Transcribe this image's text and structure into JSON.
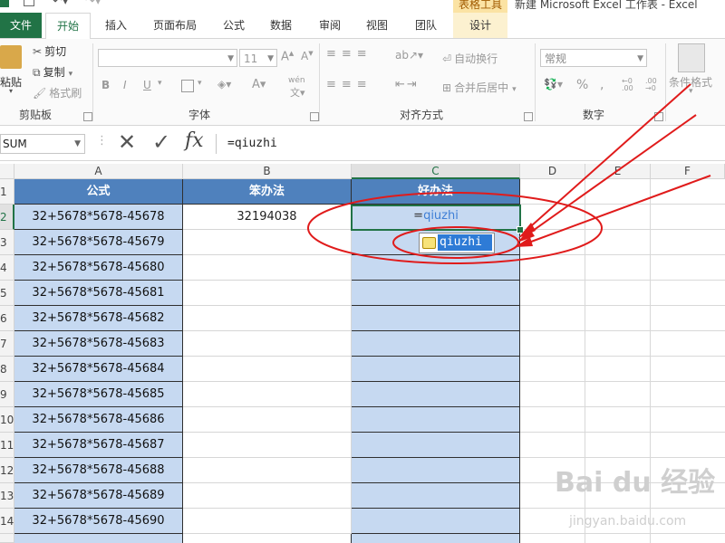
{
  "window": {
    "title": "新建 Microsoft Excel 工作表 - Excel",
    "context_tab_group": "表格工具"
  },
  "ribbon_tabs": [
    "文件",
    "开始",
    "插入",
    "页面布局",
    "公式",
    "数据",
    "审阅",
    "视图",
    "团队",
    "设计"
  ],
  "clipboard": {
    "paste": "粘贴",
    "cut": "剪切",
    "copy": "复制",
    "format_painter": "格式刷",
    "group": "剪贴板"
  },
  "font": {
    "size": "11",
    "group": "字体",
    "bold": "B",
    "italic": "I",
    "underline": "U",
    "phonetic": "wén"
  },
  "alignment": {
    "wrap_text": "自动换行",
    "merge_center": "合并后居中",
    "group": "对齐方式"
  },
  "number": {
    "format": "常规",
    "group": "数字",
    "percent": "%"
  },
  "styles": {
    "conditional_format": "条件格式"
  },
  "formula_bar": {
    "name_box": "SUM",
    "cancel": "✕",
    "enter": "✓",
    "fx": "fx",
    "content": "=qiuzhi"
  },
  "columns": [
    "A",
    "B",
    "C",
    "D",
    "E",
    "F"
  ],
  "rows": [
    "1",
    "2",
    "3",
    "4",
    "5",
    "6",
    "7",
    "8",
    "9",
    "10",
    "11",
    "12",
    "13",
    "14"
  ],
  "table": {
    "headers": [
      "公式",
      "笨办法",
      "好办法"
    ],
    "formulas": [
      "32+5678*5678-45678",
      "32+5678*5678-45679",
      "32+5678*5678-45680",
      "32+5678*5678-45681",
      "32+5678*5678-45682",
      "32+5678*5678-45683",
      "32+5678*5678-45684",
      "32+5678*5678-45685",
      "32+5678*5678-45686",
      "32+5678*5678-45687",
      "32+5678*5678-45688",
      "32+5678*5678-45689",
      "32+5678*5678-45690"
    ],
    "b2_value": "32194038"
  },
  "active_cell": {
    "eq": "=",
    "fn": "qiuzhi"
  },
  "autocomplete": {
    "item": "qiuzhi"
  },
  "colors": {
    "excel_green": "#217346",
    "header_blue": "#4f81bd",
    "body_blue": "#c6d9f1",
    "annotation_red": "#e01b1b"
  },
  "watermark": {
    "brand": "Bai du 经验",
    "url": "jingyan.baidu.com"
  }
}
